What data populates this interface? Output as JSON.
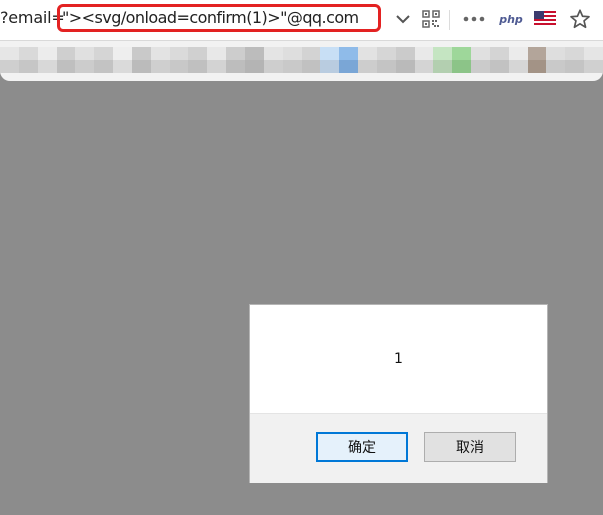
{
  "address_bar": {
    "url_prefix": "?email=",
    "url_payload": "\"><svg/onload=confirm(1)>\"@qq.com",
    "highlight_color": "#e32222"
  },
  "toolbar_icons": {
    "dropdown": "chevron-down-icon",
    "qr": "qr-code-icon",
    "more": "more-dots-icon",
    "php_label": "php",
    "flag": "us-flag-icon",
    "favorite": "star-icon"
  },
  "dialog": {
    "message": "1",
    "ok_label": "确定",
    "cancel_label": "取消"
  },
  "colors": {
    "overlay": "#8c8c8c",
    "toolbar_bg": "#ffffff",
    "dialog_footer": "#f1f1f1",
    "focus_border": "#0078d7"
  }
}
